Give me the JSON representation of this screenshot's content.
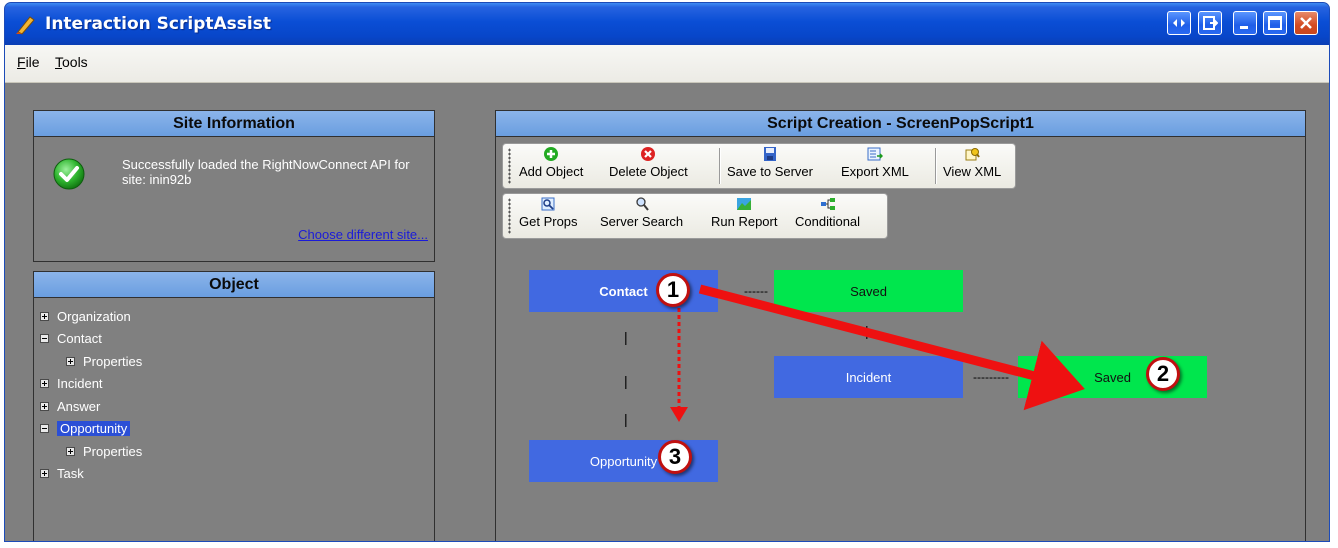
{
  "window": {
    "title": "Interaction ScriptAssist",
    "controls": [
      "restore-size-icon",
      "export-icon",
      "minimize-icon",
      "maximize-icon",
      "close-icon"
    ]
  },
  "menu": {
    "file": {
      "label": "File",
      "accelerator": "F",
      "rest": "ile"
    },
    "tools": {
      "label": "Tools",
      "accelerator": "T",
      "rest": "ools"
    }
  },
  "site_info": {
    "title": "Site Information",
    "message": "Successfully loaded the RightNowConnect API for site: inin92b",
    "link": "Choose different site..."
  },
  "object_panel": {
    "title": "Object",
    "tree": [
      {
        "label": "Organization",
        "expander": "plus",
        "level": 0,
        "selected": false
      },
      {
        "label": "Contact",
        "expander": "minus",
        "level": 0,
        "selected": false
      },
      {
        "label": "Properties",
        "expander": "plus",
        "level": 1,
        "selected": false
      },
      {
        "label": "Incident",
        "expander": "plus",
        "level": 0,
        "selected": false
      },
      {
        "label": "Answer",
        "expander": "plus",
        "level": 0,
        "selected": false
      },
      {
        "label": "Opportunity",
        "expander": "minus",
        "level": 0,
        "selected": true
      },
      {
        "label": "Properties",
        "expander": "plus",
        "level": 1,
        "selected": false
      },
      {
        "label": "Task",
        "expander": "plus",
        "level": 0,
        "selected": false
      }
    ]
  },
  "script_panel": {
    "title": "Script Creation - ScreenPopScript1",
    "toolbar1": [
      {
        "label": "Add Object",
        "icon": "add-icon"
      },
      {
        "label": "Delete Object",
        "icon": "delete-icon"
      },
      {
        "label": "Save to Server",
        "icon": "save-icon"
      },
      {
        "label": "Export XML",
        "icon": "export-xml-icon"
      },
      {
        "label": "View XML",
        "icon": "view-xml-icon"
      }
    ],
    "toolbar2": [
      {
        "label": "Get Props",
        "icon": "get-props-icon"
      },
      {
        "label": "Server Search",
        "icon": "server-search-icon"
      },
      {
        "label": "Run Report",
        "icon": "run-report-icon"
      },
      {
        "label": "Conditional",
        "icon": "conditional-icon"
      }
    ],
    "nodes": {
      "contact": "Contact",
      "saved1": "Saved",
      "incident": "Incident",
      "saved2": "Saved",
      "opportunity": "Opportunity"
    },
    "connectors": {
      "contact_saved": "------",
      "incident_saved": "---------",
      "vertical_bar": "|"
    }
  },
  "annotations": {
    "badge1": "1",
    "badge2": "2",
    "badge3": "3",
    "arrow_color": "#ee1111"
  }
}
